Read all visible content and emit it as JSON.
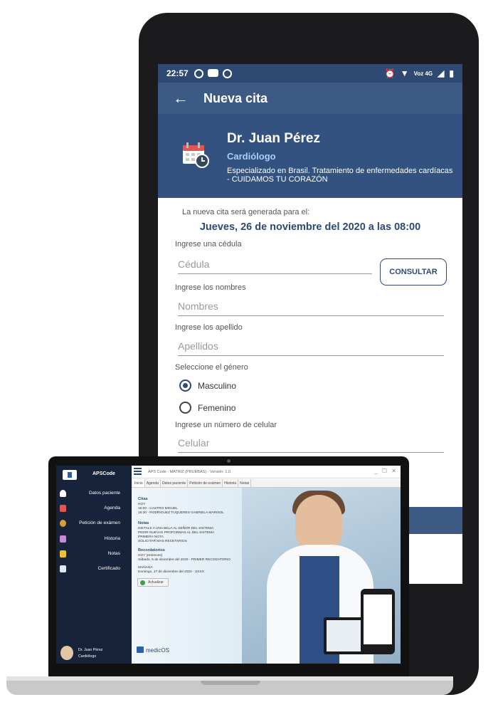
{
  "phone": {
    "status": {
      "time": "22:57",
      "network": "Voz 4G"
    },
    "appbar": {
      "title": "Nueva cita"
    },
    "doctor": {
      "name": "Dr. Juan Pérez",
      "specialty": "Cardiólogo",
      "description": "Especializado en Brasil. Tratamiento de enfermedades cardíacas - CUIDAMOS TU CORAZÓN"
    },
    "appointment": {
      "label": "La nueva cita será generada para el:",
      "datetime": "Jueves, 26 de noviembre del 2020 a las 08:00"
    },
    "form": {
      "id_label": "Ingrese una cédula",
      "id_placeholder": "Cédula",
      "consult_button": "CONSULTAR",
      "names_label": "Ingrese los nombres",
      "names_placeholder": "Nombres",
      "lastnames_label": "Ingrese los apellido",
      "lastnames_placeholder": "Apellidos",
      "gender_label": "Seleccione el género",
      "gender_options": [
        {
          "label": "Masculino",
          "selected": true
        },
        {
          "label": "Femenino",
          "selected": false
        }
      ],
      "phone_label": "Ingrese un número de celular",
      "phone_placeholder": "Celular"
    },
    "colors": {
      "primary": "#3d5a85",
      "header": "#33527f",
      "accent": "#a8d0f5"
    }
  },
  "laptop": {
    "sidebar": {
      "brand": "APSCode",
      "items": [
        {
          "label": "Datos paciente",
          "icon": "user-icon"
        },
        {
          "label": "Agenda",
          "icon": "calendar-icon"
        },
        {
          "label": "Petición de exámen",
          "icon": "exam-icon"
        },
        {
          "label": "Historia",
          "icon": "history-icon"
        },
        {
          "label": "Notas",
          "icon": "note-icon"
        },
        {
          "label": "Certificado",
          "icon": "certificate-icon"
        }
      ],
      "user": {
        "name": "Dr. Juan Pérez",
        "role": "Cardiólogo"
      }
    },
    "window": {
      "title": "APS Code - MATRIZ (PRUEBAS) - Versión: 1.0",
      "controls": "_ ☐ ✕"
    },
    "tabs": [
      "Inicio",
      "Agenda",
      "Datos paciente",
      "Petición de exámen",
      "Historia",
      "Notas"
    ],
    "content": {
      "citas_title": "Citas",
      "citas_lines": [
        "HOY",
        "16:00 - CASTRO MIGUEL",
        "16:30 - RODRIGUEZ TUQUERES GABRIELA MARISOL"
      ],
      "notas_title": "Notas",
      "notas_lines": [
        "INSTALE A UNA BELA AL SEÑOR DEL SISTEMA",
        "PEDIR NUEVAS PROFORMAS AL DEL SISTEMA",
        "PRIMERA NOTA",
        "SOLICITAR MAS RECETARIOS"
      ],
      "recordatorios_title": "Recordatorios",
      "recordatorios_lines": [
        "HOY (entonces)",
        "Sábado, 5 de diciembre del 2020 - PRIMER RECODATORIO",
        "",
        "MAÑANA",
        "Domingo, 27 de diciembre del 2020 - XXXX"
      ],
      "refresh_button": "Actualizar"
    },
    "footer_brand": "medicOS"
  }
}
